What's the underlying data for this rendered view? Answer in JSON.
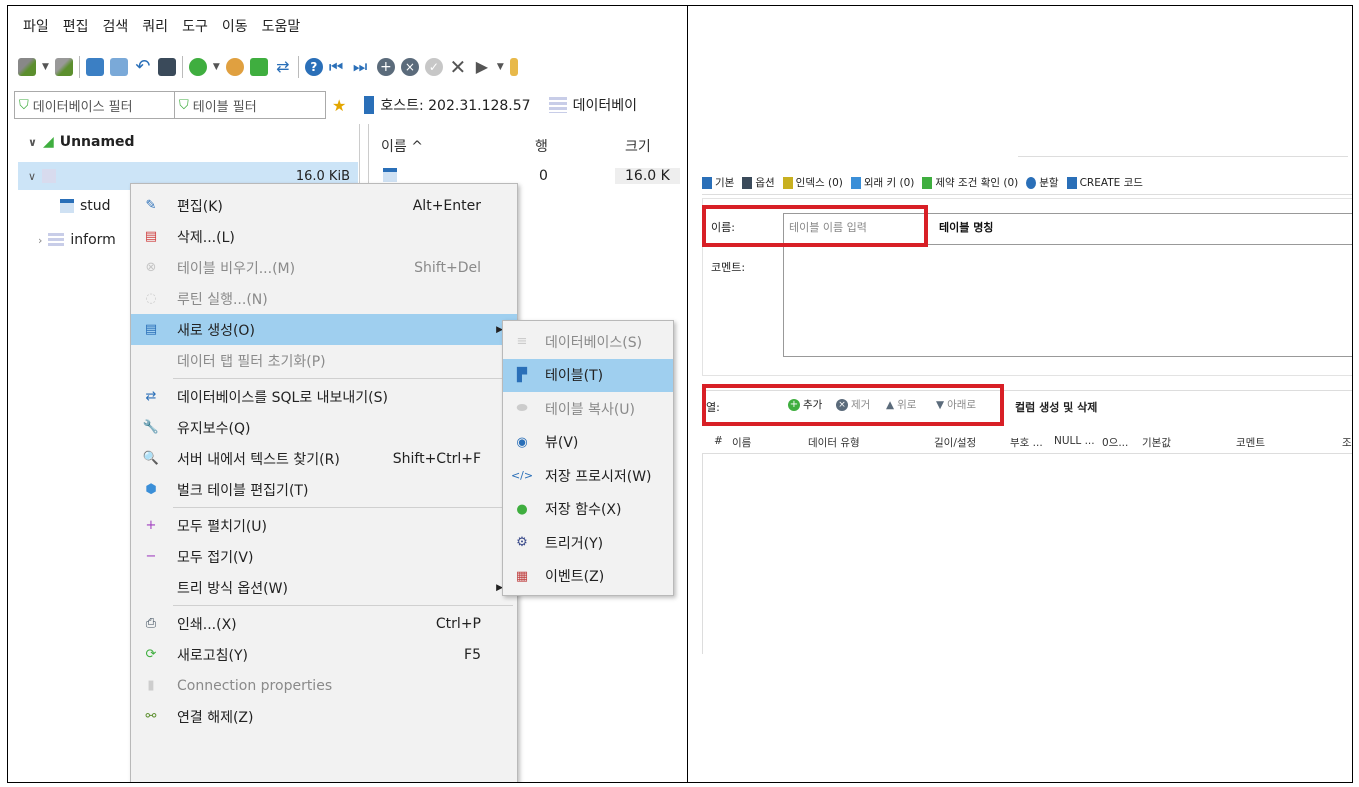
{
  "menubar": [
    "파일",
    "편집",
    "검색",
    "쿼리",
    "도구",
    "이동",
    "도움말"
  ],
  "filters": {
    "db_filter": "데이터베이스 필터",
    "table_filter": "테이블 필터"
  },
  "host_tab": "호스트: 202.31.128.57",
  "db_tab": "데이터베이",
  "tree": {
    "root": "Unnamed",
    "selected_size": "16.0 KiB",
    "child1": "stud",
    "child2": "inform"
  },
  "grid": {
    "col_name": "이름 ^",
    "col_rows": "행",
    "col_size": "크기",
    "rows_value": "0",
    "size_value": "16.0 K"
  },
  "context_menu": [
    {
      "label": "편집(K)",
      "shortcut": "Alt+Enter",
      "icon": "edit-icon",
      "disabled": false
    },
    {
      "label": "삭제...(L)",
      "shortcut": "",
      "icon": "delete-icon",
      "disabled": false
    },
    {
      "label": "테이블 비우기...(M)",
      "shortcut": "Shift+Del",
      "icon": "empty-icon",
      "disabled": true
    },
    {
      "label": "루틴 실행...(N)",
      "shortcut": "",
      "icon": "routine-icon",
      "disabled": true
    },
    {
      "label": "새로 생성(O)",
      "shortcut": "",
      "icon": "new-icon",
      "disabled": false,
      "highlighted": true,
      "submenu": true
    },
    {
      "label": "데이터 탭 필터 초기화(P)",
      "shortcut": "",
      "icon": "",
      "disabled": true
    },
    {
      "label": "데이터베이스를 SQL로 내보내기(S)",
      "shortcut": "",
      "icon": "export-icon",
      "disabled": false
    },
    {
      "label": "유지보수(Q)",
      "shortcut": "",
      "icon": "wrench-icon",
      "disabled": false
    },
    {
      "label": "서버 내에서 텍스트 찾기(R)",
      "shortcut": "Shift+Ctrl+F",
      "icon": "search-icon",
      "disabled": false
    },
    {
      "label": "벌크 테이블 편집기(T)",
      "shortcut": "",
      "icon": "bulk-icon",
      "disabled": false
    },
    {
      "label": "모두 펼치기(U)",
      "shortcut": "",
      "icon": "expand-icon",
      "disabled": false
    },
    {
      "label": "모두 접기(V)",
      "shortcut": "",
      "icon": "collapse-icon",
      "disabled": false
    },
    {
      "label": "트리 방식 옵션(W)",
      "shortcut": "",
      "icon": "",
      "disabled": false,
      "submenu": true
    },
    {
      "label": "인쇄...(X)",
      "shortcut": "Ctrl+P",
      "icon": "print-icon",
      "disabled": false
    },
    {
      "label": "새로고침(Y)",
      "shortcut": "F5",
      "icon": "refresh-icon",
      "disabled": false
    },
    {
      "label": "Connection properties",
      "shortcut": "",
      "icon": "properties-icon",
      "disabled": true
    },
    {
      "label": "연결 해제(Z)",
      "shortcut": "",
      "icon": "disconnect-icon",
      "disabled": false
    }
  ],
  "submenu": [
    {
      "label": "데이터베이스(S)",
      "icon": "database-icon",
      "disabled": true
    },
    {
      "label": "테이블(T)",
      "icon": "table-icon",
      "disabled": false,
      "highlighted": true
    },
    {
      "label": "테이블 복사(U)",
      "icon": "table-copy-icon",
      "disabled": true
    },
    {
      "label": "뷰(V)",
      "icon": "eye-icon",
      "disabled": false
    },
    {
      "label": "저장 프로시저(W)",
      "icon": "code-icon",
      "disabled": false
    },
    {
      "label": "저장 함수(X)",
      "icon": "function-icon",
      "disabled": false
    },
    {
      "label": "트리거(Y)",
      "icon": "gear-icon",
      "disabled": false
    },
    {
      "label": "이벤트(Z)",
      "icon": "calendar-icon",
      "disabled": false
    }
  ],
  "right": {
    "tabs": [
      "기본",
      "옵션",
      "인덱스 (0)",
      "외래 키 (0)",
      "제약 조건 확인 (0)",
      "분할",
      "CREATE 코드"
    ],
    "name_label": "이름:",
    "name_placeholder": "테이블 이름 입력",
    "name_annotation": "테이블 명칭",
    "comment_label": "코멘트:",
    "cols_label": "열:",
    "add": "추가",
    "remove": "제거",
    "up": "위로",
    "down": "아래로",
    "cols_annotation": "컬럼 생성 및 삭제",
    "columns": [
      "#",
      "이름",
      "데이터 유형",
      "길이/설정",
      "부호 ...",
      "NULL ...",
      "0으...",
      "기본값",
      "코멘트",
      "조"
    ]
  },
  "colors": {
    "highlight": "#9fcfef",
    "selection": "#cce4f7",
    "annotation_box": "#d81f26"
  }
}
